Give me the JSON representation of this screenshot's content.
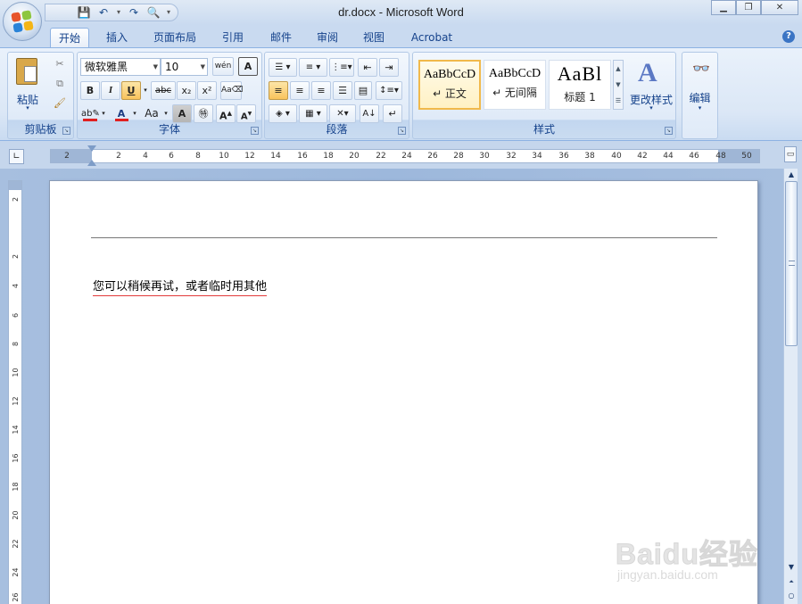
{
  "window": {
    "title": "dr.docx - Microsoft Word",
    "controls": [
      "minimize",
      "restore",
      "close"
    ]
  },
  "quick_access": {
    "items": [
      "save-icon",
      "undo-icon",
      "redo-icon",
      "print-preview-icon",
      "customize-icon"
    ]
  },
  "tabs": [
    {
      "label": "开始",
      "active": true
    },
    {
      "label": "插入",
      "active": false
    },
    {
      "label": "页面布局",
      "active": false
    },
    {
      "label": "引用",
      "active": false
    },
    {
      "label": "邮件",
      "active": false
    },
    {
      "label": "审阅",
      "active": false
    },
    {
      "label": "视图",
      "active": false
    },
    {
      "label": "Acrobat",
      "active": false
    }
  ],
  "ribbon": {
    "clipboard": {
      "label": "剪贴板",
      "paste": "粘贴"
    },
    "font": {
      "label": "字体",
      "font_name": "微软雅黑",
      "font_size": "10",
      "bold": "B",
      "italic": "I",
      "underline": "U",
      "strike": "abc",
      "subscript": "x₂",
      "superscript": "x²",
      "grow": "A",
      "shrink": "A",
      "change_case": "Aa",
      "char_shading": "A",
      "wen": "wén",
      "char_border": "A"
    },
    "paragraph": {
      "label": "段落"
    },
    "styles": {
      "label": "样式",
      "items": [
        {
          "sample": "AaBbCcD",
          "name": "↵ 正文",
          "selected": true
        },
        {
          "sample": "AaBbCcD",
          "name": "↵ 无间隔",
          "selected": false
        },
        {
          "sample": "AaBl",
          "name": "标题 1",
          "selected": false
        }
      ],
      "change_styles": "更改样式"
    },
    "editing": {
      "label": "编辑"
    }
  },
  "ruler": {
    "ticks": [
      "2",
      "2",
      "4",
      "6",
      "8",
      "10",
      "12",
      "14",
      "16",
      "18",
      "20",
      "22",
      "24",
      "26",
      "28",
      "30",
      "32",
      "34",
      "36",
      "38",
      "40",
      "42",
      "44",
      "46",
      "48",
      "50"
    ],
    "vticks": [
      "2",
      "2",
      "4",
      "6",
      "8",
      "10",
      "12",
      "14",
      "16",
      "18",
      "20",
      "22",
      "24",
      "26"
    ]
  },
  "document": {
    "body_text": "您可以稍候再试，或者临时用其他"
  },
  "watermark": {
    "main": "Baidu经验",
    "sub": "jingyan.baidu.com"
  },
  "colors": {
    "accent": "#15428b",
    "ribbon_bg": "#dbe7f6",
    "highlight": "#f9c35c",
    "font_color": "#e02020",
    "highlight_color": "#ffff00"
  }
}
